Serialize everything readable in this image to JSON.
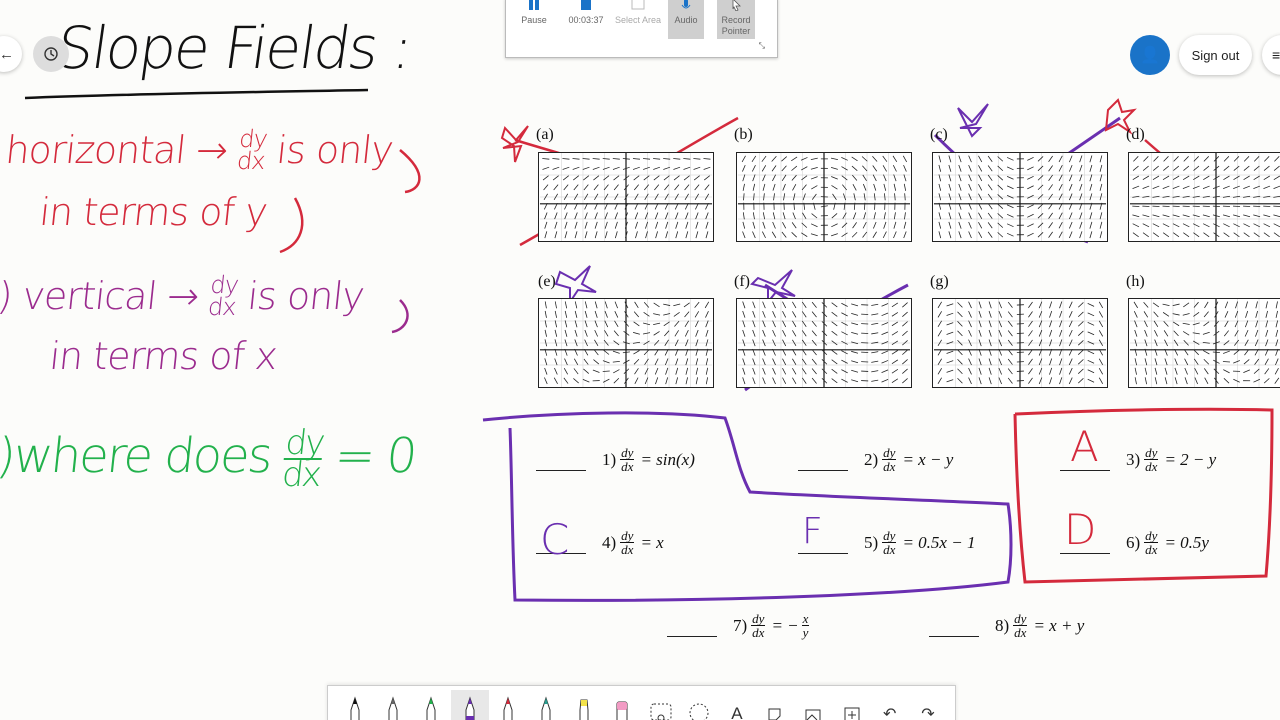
{
  "title_text": "Slope Fields :",
  "notes": {
    "line1a": "horizontal → ",
    "line1_frac_top": "dy",
    "line1_frac_bot": "dx",
    "line1b": " is only",
    "line2": "in terms of y",
    "line3_prefix": ")",
    "line3a": " vertical → ",
    "line3_frac_top": "dy",
    "line3_frac_bot": "dx",
    "line3b": " is only",
    "line4": "in terms of x",
    "line5_prefix": ")",
    "line5a": "where does ",
    "line5_frac_top": "dy",
    "line5_frac_bot": "dx",
    "line5b": " = 0"
  },
  "recorder": {
    "pause_label": "Pause",
    "timer": "00:03:37",
    "select_area_label": "Select Area",
    "audio_label": "Audio",
    "record_pointer_label": "Record Pointer"
  },
  "header": {
    "sign_out_label": "Sign out"
  },
  "slope_field_labels": [
    "(a)",
    "(b)",
    "(c)",
    "(d)",
    "(e)",
    "(f)",
    "(g)",
    "(h)"
  ],
  "equations": [
    {
      "num": "1)",
      "frac_top": "dy",
      "frac_bot": "dx",
      "rhs": "= sin(x)",
      "answer": ""
    },
    {
      "num": "2)",
      "frac_top": "dy",
      "frac_bot": "dx",
      "rhs": "= x − y",
      "answer": ""
    },
    {
      "num": "3)",
      "frac_top": "dy",
      "frac_bot": "dx",
      "rhs": "= 2 − y",
      "answer": "A"
    },
    {
      "num": "4)",
      "frac_top": "dy",
      "frac_bot": "dx",
      "rhs": "= x",
      "answer": "C"
    },
    {
      "num": "5)",
      "frac_top": "dy",
      "frac_bot": "dx",
      "rhs": "= 0.5x − 1",
      "answer": "F"
    },
    {
      "num": "6)",
      "frac_top": "dy",
      "frac_bot": "dx",
      "rhs": "= 0.5y",
      "answer": "D"
    },
    {
      "num": "7)",
      "frac_top": "dy",
      "frac_bot": "dx",
      "rhs_prefix": "= −",
      "rhs_frac_top": "x",
      "rhs_frac_bot": "y",
      "answer": ""
    },
    {
      "num": "8)",
      "frac_top": "dy",
      "frac_bot": "dx",
      "rhs": "= x + y",
      "answer": ""
    }
  ],
  "colors": {
    "red_ink": "#d42a3c",
    "purple_ink": "#9b2b8e",
    "violet_ink": "#6a2fb0",
    "green_ink": "#22b14c",
    "accent_blue": "#1a73c8"
  },
  "toolbar": {
    "tools": [
      "pen-black",
      "pen-gray",
      "pen-green",
      "pen-purple",
      "pen-red",
      "pen-teal",
      "highlighter",
      "eraser",
      "lasso-select",
      "circle-select",
      "text-tool",
      "shapes-tool",
      "image-tool",
      "add-page",
      "undo",
      "redo"
    ],
    "text_tool_glyph": "A"
  }
}
